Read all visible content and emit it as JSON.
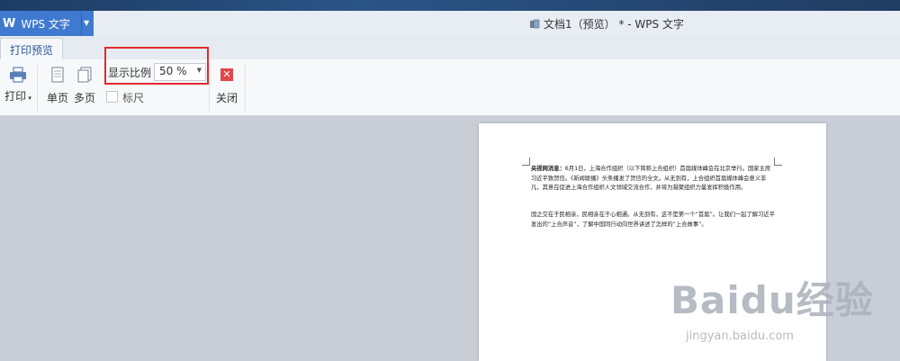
{
  "app": {
    "logo": "W",
    "name": "WPS 文字"
  },
  "window": {
    "title": "文档1（预览） * - WPS 文字"
  },
  "tabs": {
    "active": "打印预览"
  },
  "ribbon": {
    "print": "打印",
    "single_page": "单页",
    "multi_page": "多页",
    "zoom_label": "显示比例",
    "zoom_value": "50 %",
    "ruler": "标尺",
    "close": "关闭"
  },
  "document": {
    "paragraph1_bold": "央视网消息：",
    "paragraph1_body": "6月1日，上海合作组织（以下简称上合组织）首届媒体峰会在北京举行。国家主席习近平致贺信。《新闻联播》头条播发了贺信的全文。从无到有，上合组织首届媒体峰会意义非凡，其意在促进上海合作组织人文领域交流合作，并将为凝聚组织力量发挥积极作用。",
    "paragraph2": "国之交在于民相亲，民相亲在于心相通。从无到有，这不是第一个“首届”。让我们一起了解习近平发出的“上合声音”，了解中国同行动向世界讲述了怎样的“上合故事”。"
  },
  "watermark": {
    "brand": "Baidu经验",
    "url": "jingyan.baidu.com"
  },
  "colors": {
    "accent": "#3f7ad0",
    "highlight": "#e12a2a",
    "close": "#e0474b"
  }
}
